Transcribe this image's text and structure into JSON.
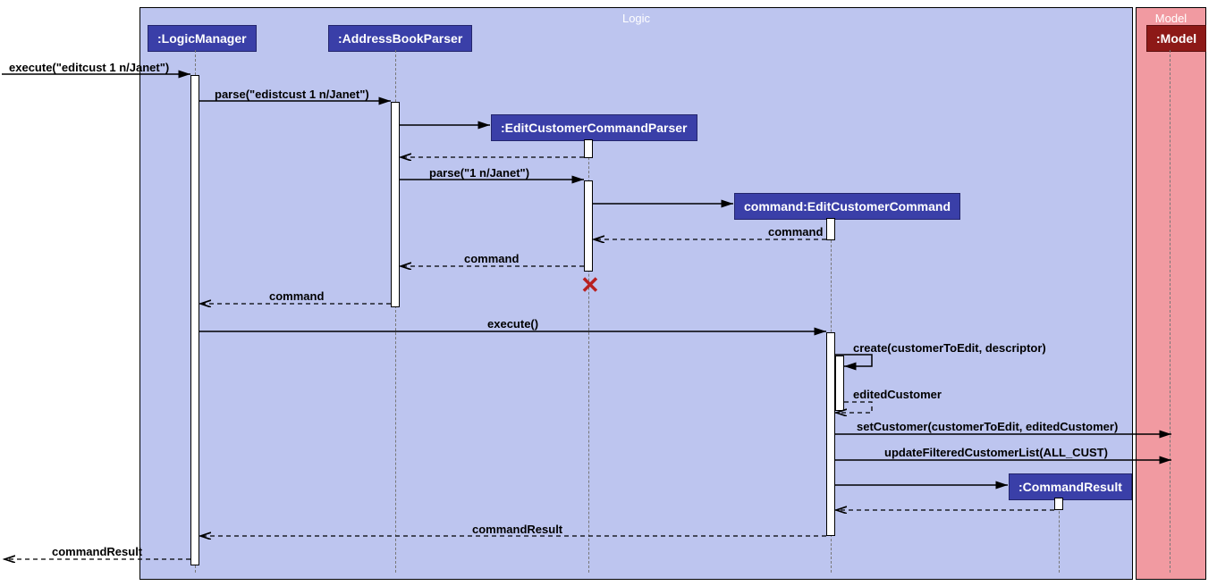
{
  "frames": {
    "logic": "Logic",
    "model": "Model"
  },
  "participants": {
    "logicManager": ":LogicManager",
    "addressBookParser": ":AddressBookParser",
    "editCustomerCommandParser": ":EditCustomerCommandParser",
    "editCustomerCommand": "command:EditCustomerCommand",
    "commandResult": ":CommandResult",
    "model": ":Model"
  },
  "messages": {
    "executeIn": "execute(\"editcust 1 n/Janet\")",
    "parse1": "parse(\"edistcust 1 n/Janet\")",
    "parse2": "parse(\"1 n/Janet\")",
    "commandReturn1": "command",
    "commandReturn2": "command",
    "commandReturn3": "command",
    "execute": "execute()",
    "create": "create(customerToEdit, descriptor)",
    "editedCustomer": "editedCustomer",
    "setCustomer": "setCustomer(customerToEdit, editedCustomer)",
    "updateList": "updateFilteredCustomerList(ALL_CUST)",
    "commandResultReturn": "commandResult",
    "commandResultOut": "commandResult"
  }
}
